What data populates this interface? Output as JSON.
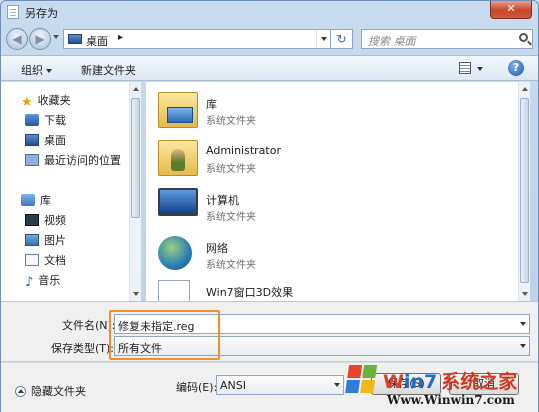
{
  "window": {
    "title": "另存为",
    "close_label": "✕"
  },
  "address": {
    "crumb": "桌面",
    "crumb_separator": "▸",
    "refresh_glyph": "↻",
    "search_placeholder": "搜索 桌面"
  },
  "toolbar": {
    "organize_label": "组织",
    "new_folder_label": "新建文件夹",
    "help_glyph": "?"
  },
  "nav": {
    "favorites_label": "收藏夹",
    "favorites": [
      {
        "label": "下载",
        "icon": "download-icon"
      },
      {
        "label": "桌面",
        "icon": "desktop-icon"
      },
      {
        "label": "最近访问的位置",
        "icon": "recent-places-icon"
      }
    ],
    "libraries_label": "库",
    "libraries": [
      {
        "label": "视频",
        "icon": "video-icon"
      },
      {
        "label": "图片",
        "icon": "pictures-icon"
      },
      {
        "label": "文档",
        "icon": "documents-icon"
      },
      {
        "label": "音乐",
        "icon": "music-icon"
      }
    ]
  },
  "files": [
    {
      "name": "库",
      "type": "系统文件夹",
      "icon": "libraries-folder-icon"
    },
    {
      "name": "Administrator",
      "type": "系统文件夹",
      "icon": "user-folder-icon"
    },
    {
      "name": "计算机",
      "type": "系统文件夹",
      "icon": "computer-icon"
    },
    {
      "name": "网络",
      "type": "系统文件夹",
      "icon": "network-icon"
    },
    {
      "name": "Win7窗口3D效果",
      "type": "",
      "icon": "document-icon"
    }
  ],
  "form": {
    "filename_label": "文件名(N):",
    "filename_value": "修复未指定.reg",
    "filetype_label": "保存类型(T):",
    "filetype_value": "所有文件"
  },
  "bottom": {
    "hide_folders_label": "隐藏文件夹",
    "encoding_label": "编码(E):",
    "encoding_value": "ANSI",
    "save_label": "保存(S)",
    "cancel_label": "取消"
  },
  "watermark": {
    "brand_a": "W",
    "brand_b": "in7",
    "brand_c": "系统之家",
    "url": "Www.Winwin7.com"
  },
  "colors": {
    "highlight_border": "#f0902a",
    "titlebar": "#c9dcef",
    "close_button": "#c7452b"
  }
}
